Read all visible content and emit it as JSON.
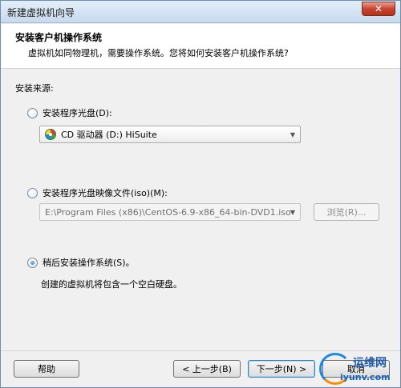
{
  "window": {
    "title": "新建虚拟机向导",
    "close_label": "✕"
  },
  "header": {
    "title": "安装客户机操作系统",
    "description": "虚拟机如同物理机，需要操作系统。您将如何安装客户机操作系统?"
  },
  "source_label": "安装来源:",
  "options": {
    "disc": {
      "label": "安装程序光盘(D):",
      "selected": false,
      "dropdown_value": "CD 驱动器 (D:) HiSuite",
      "icon": "cd-drive-icon"
    },
    "iso": {
      "label": "安装程序光盘映像文件(iso)(M):",
      "selected": false,
      "path_value": "E:\\Program Files (x86)\\CentOS-6.9-x86_64-bin-DVD1.iso",
      "browse_label": "浏览(R)..."
    },
    "later": {
      "label": "稍后安装操作系统(S)。",
      "selected": true,
      "description": "创建的虚拟机将包含一个空白硬盘。"
    }
  },
  "footer": {
    "help_label": "帮助",
    "back_label": "< 上一步(B)",
    "next_label": "下一步(N) >",
    "cancel_label": "取消"
  },
  "watermark": {
    "name": "运维网",
    "url": "iyunv.com"
  }
}
